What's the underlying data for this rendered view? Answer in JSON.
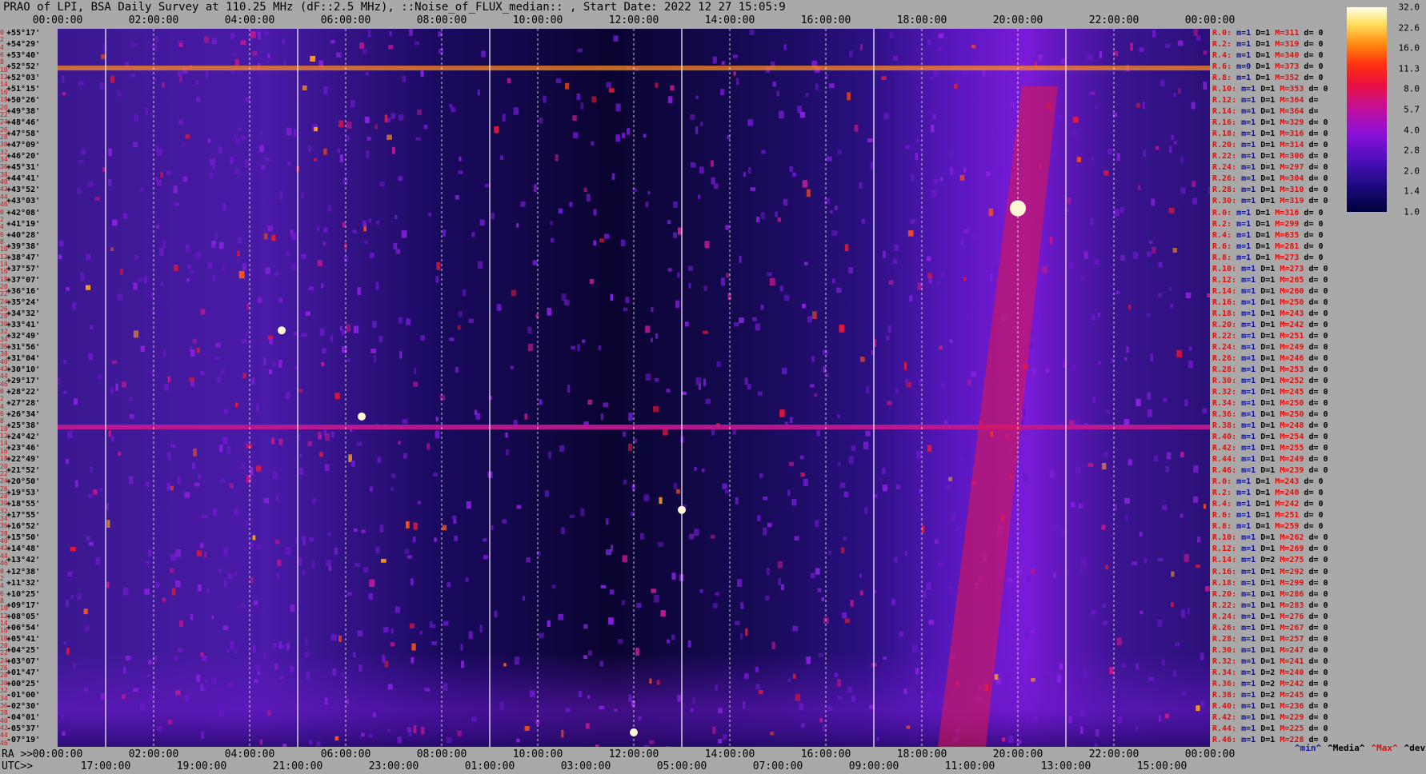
{
  "title": "PRAO of LPI, BSA Daily Survey at 110.25 MHz (dF::2.5 MHz), ::Noise_of_FLUX_median:: , Start Date: 2022 12 27 15:05:9",
  "top_axis_ticks": [
    "00:00:00",
    "02:00:00",
    "04:00:00",
    "06:00:00",
    "08:00:00",
    "10:00:00",
    "12:00:00",
    "14:00:00",
    "16:00:00",
    "18:00:00",
    "20:00:00",
    "22:00:00",
    "00:00:00"
  ],
  "bottom_axis": {
    "ra_prefix": "RA >>",
    "utc_prefix": "UTC>>",
    "ra_ticks": [
      "00:00:00",
      "02:00:00",
      "04:00:00",
      "06:00:00",
      "08:00:00",
      "10:00:00",
      "12:00:00",
      "14:00:00",
      "16:00:00",
      "18:00:00",
      "20:00:00",
      "22:00:00",
      "00:00:00"
    ],
    "utc_ticks": [
      "17:00:00",
      "19:00:00",
      "21:00:00",
      "23:00:00",
      "01:00:00",
      "03:00:00",
      "05:00:00",
      "07:00:00",
      "09:00:00",
      "11:00:00",
      "13:00:00",
      "15:00:00"
    ]
  },
  "legend_keys": [
    {
      "label": "^min^",
      "color": "#1a1a9a"
    },
    {
      "label": "^Media^",
      "color": "#000000"
    },
    {
      "label": "^Max^",
      "color": "#e01010"
    },
    {
      "label": "^devia^",
      "color": "#000000"
    }
  ],
  "colorbar": {
    "labels": [
      "32.0",
      "22.6",
      "16.0",
      "11.3",
      "8.0",
      "5.7",
      "4.0",
      "2.8",
      "2.0",
      "1.4",
      "1.0"
    ]
  },
  "declinations": [
    "+55°17'",
    "+54°29'",
    "+53°40'",
    "+52°52'",
    "+52°03'",
    "+51°15'",
    "+50°26'",
    "+49°38'",
    "+48°46'",
    "+47°58'",
    "+47°09'",
    "+46°20'",
    "+45°31'",
    "+44°41'",
    "+43°52'",
    "+43°03'",
    "+42°08'",
    "+41°19'",
    "+40°28'",
    "+39°38'",
    "+38°47'",
    "+37°57'",
    "+37°07'",
    "+36°16'",
    "+35°24'",
    "+34°32'",
    "+33°41'",
    "+32°49'",
    "+31°56'",
    "+31°04'",
    "+30°10'",
    "+29°17'",
    "+28°22'",
    "+27°28'",
    "+26°34'",
    "+25°38'",
    "+24°42'",
    "+23°46'",
    "+22°49'",
    "+21°52'",
    "+20°50'",
    "+19°53'",
    "+18°55'",
    "+17°55'",
    "+16°52'",
    "+15°50'",
    "+14°48'",
    "+13°42'",
    "+12°38'",
    "+11°32'",
    "+10°25'",
    "+09°17'",
    "+08°05'",
    "+06°54'",
    "+05°41'",
    "+04°25'",
    "+03°07'",
    "+01°47'",
    "+00°25'",
    "-01°00'",
    "-02°30'",
    "-04°01'",
    "-05°37'",
    "-07°19'"
  ],
  "row_indices": [
    "0",
    "2",
    "4",
    "6",
    "8",
    "10",
    "12",
    "14",
    "16",
    "18",
    "20",
    "22",
    "24",
    "26",
    "28",
    "30",
    "32",
    "34",
    "36",
    "38",
    "40",
    "42",
    "44",
    "46",
    "0",
    "2",
    "4",
    "6",
    "8",
    "10",
    "12",
    "14",
    "16",
    "18",
    "20",
    "22",
    "24",
    "26",
    "28",
    "30",
    "32",
    "34",
    "36",
    "38",
    "40",
    "42",
    "44",
    "46",
    "0",
    "2",
    "4",
    "6",
    "8",
    "10",
    "12",
    "14",
    "16",
    "18",
    "20",
    "22",
    "24",
    "26",
    "28",
    "30",
    "32",
    "34",
    "36",
    "38",
    "40",
    "42",
    "44",
    "46",
    "0",
    "2",
    "4",
    "6",
    "8",
    "10",
    "12",
    "14",
    "16",
    "18",
    "20",
    "22",
    "24",
    "26",
    "28",
    "30",
    "32",
    "34",
    "36",
    "38",
    "40",
    "42",
    "44",
    "46"
  ],
  "stats": [
    {
      "r": "R.0:",
      "m": "m=1",
      "D": "D=1",
      "M": "M=311",
      "d": "d= 0"
    },
    {
      "r": "R.2:",
      "m": "m=1",
      "D": "D=1",
      "M": "M=319",
      "d": "d= 0"
    },
    {
      "r": "R.4:",
      "m": "m=1",
      "D": "D=1",
      "M": "M=340",
      "d": "d= 0"
    },
    {
      "r": "R.6:",
      "m": "m=0",
      "D": "D=1",
      "M": "M=373",
      "d": "d= 0"
    },
    {
      "r": "R.8:",
      "m": "m=1",
      "D": "D=1",
      "M": "M=352",
      "d": "d= 0"
    },
    {
      "r": "R.10:",
      "m": "m=1",
      "D": "D=1",
      "M": "M=353",
      "d": "d= 0"
    },
    {
      "r": "R.12:",
      "m": "m=1",
      "D": "D=1",
      "M": "M=364",
      "d": "d="
    },
    {
      "r": "R.14:",
      "m": "m=1",
      "D": "D=1",
      "M": "M=364",
      "d": "d="
    },
    {
      "r": "R.16:",
      "m": "m=1",
      "D": "D=1",
      "M": "M=329",
      "d": "d= 0"
    },
    {
      "r": "R.18:",
      "m": "m=1",
      "D": "D=1",
      "M": "M=316",
      "d": "d= 0"
    },
    {
      "r": "R.20:",
      "m": "m=1",
      "D": "D=1",
      "M": "M=314",
      "d": "d= 0"
    },
    {
      "r": "R.22:",
      "m": "m=1",
      "D": "D=1",
      "M": "M=306",
      "d": "d= 0"
    },
    {
      "r": "R.24:",
      "m": "m=1",
      "D": "D=1",
      "M": "M=297",
      "d": "d= 0"
    },
    {
      "r": "R.26:",
      "m": "m=1",
      "D": "D=1",
      "M": "M=304",
      "d": "d= 0"
    },
    {
      "r": "R.28:",
      "m": "m=1",
      "D": "D=1",
      "M": "M=310",
      "d": "d= 0"
    },
    {
      "r": "R.30:",
      "m": "m=1",
      "D": "D=1",
      "M": "M=319",
      "d": "d= 0"
    },
    {
      "r": "R.0:",
      "m": "m=1",
      "D": "D=1",
      "M": "M=316",
      "d": "d= 0"
    },
    {
      "r": "R.2:",
      "m": "m=1",
      "D": "D=1",
      "M": "M=299",
      "d": "d= 0"
    },
    {
      "r": "R.4:",
      "m": "m=1",
      "D": "D=1",
      "M": "M=635",
      "d": "d= 0"
    },
    {
      "r": "R.6:",
      "m": "m=1",
      "D": "D=1",
      "M": "M=281",
      "d": "d= 0"
    },
    {
      "r": "R.8:",
      "m": "m=1",
      "D": "D=1",
      "M": "M=273",
      "d": "d= 0"
    },
    {
      "r": "R.10:",
      "m": "m=1",
      "D": "D=1",
      "M": "M=273",
      "d": "d= 0"
    },
    {
      "r": "R.12:",
      "m": "m=1",
      "D": "D=1",
      "M": "M=265",
      "d": "d= 0"
    },
    {
      "r": "R.14:",
      "m": "m=1",
      "D": "D=1",
      "M": "M=260",
      "d": "d= 0"
    },
    {
      "r": "R.16:",
      "m": "m=1",
      "D": "D=1",
      "M": "M=250",
      "d": "d= 0"
    },
    {
      "r": "R.18:",
      "m": "m=1",
      "D": "D=1",
      "M": "M=243",
      "d": "d= 0"
    },
    {
      "r": "R.20:",
      "m": "m=1",
      "D": "D=1",
      "M": "M=242",
      "d": "d= 0"
    },
    {
      "r": "R.22:",
      "m": "m=1",
      "D": "D=1",
      "M": "M=251",
      "d": "d= 0"
    },
    {
      "r": "R.24:",
      "m": "m=1",
      "D": "D=1",
      "M": "M=249",
      "d": "d= 0"
    },
    {
      "r": "R.26:",
      "m": "m=1",
      "D": "D=1",
      "M": "M=246",
      "d": "d= 0"
    },
    {
      "r": "R.28:",
      "m": "m=1",
      "D": "D=1",
      "M": "M=253",
      "d": "d= 0"
    },
    {
      "r": "R.30:",
      "m": "m=1",
      "D": "D=1",
      "M": "M=252",
      "d": "d= 0"
    },
    {
      "r": "R.32:",
      "m": "m=1",
      "D": "D=1",
      "M": "M=245",
      "d": "d= 0"
    },
    {
      "r": "R.34:",
      "m": "m=1",
      "D": "D=1",
      "M": "M=250",
      "d": "d= 0"
    },
    {
      "r": "R.36:",
      "m": "m=1",
      "D": "D=1",
      "M": "M=250",
      "d": "d= 0"
    },
    {
      "r": "R.38:",
      "m": "m=1",
      "D": "D=1",
      "M": "M=248",
      "d": "d= 0"
    },
    {
      "r": "R.40:",
      "m": "m=1",
      "D": "D=1",
      "M": "M=254",
      "d": "d= 0"
    },
    {
      "r": "R.42:",
      "m": "m=1",
      "D": "D=1",
      "M": "M=255",
      "d": "d= 0"
    },
    {
      "r": "R.44:",
      "m": "m=1",
      "D": "D=1",
      "M": "M=249",
      "d": "d= 0"
    },
    {
      "r": "R.46:",
      "m": "m=1",
      "D": "D=1",
      "M": "M=239",
      "d": "d= 0"
    },
    {
      "r": "R.0:",
      "m": "m=1",
      "D": "D=1",
      "M": "M=243",
      "d": "d= 0"
    },
    {
      "r": "R.2:",
      "m": "m=1",
      "D": "D=1",
      "M": "M=240",
      "d": "d= 0"
    },
    {
      "r": "R.4:",
      "m": "m=1",
      "D": "D=1",
      "M": "M=242",
      "d": "d= 0"
    },
    {
      "r": "R.6:",
      "m": "m=1",
      "D": "D=1",
      "M": "M=251",
      "d": "d= 0"
    },
    {
      "r": "R.8:",
      "m": "m=1",
      "D": "D=1",
      "M": "M=259",
      "d": "d= 0"
    },
    {
      "r": "R.10:",
      "m": "m=1",
      "D": "D=1",
      "M": "M=262",
      "d": "d= 0"
    },
    {
      "r": "R.12:",
      "m": "m=1",
      "D": "D=1",
      "M": "M=269",
      "d": "d= 0"
    },
    {
      "r": "R.14:",
      "m": "m=1",
      "D": "D=2",
      "M": "M=275",
      "d": "d= 0"
    },
    {
      "r": "R.16:",
      "m": "m=1",
      "D": "D=1",
      "M": "M=292",
      "d": "d= 0"
    },
    {
      "r": "R.18:",
      "m": "m=1",
      "D": "D=1",
      "M": "M=299",
      "d": "d= 0"
    },
    {
      "r": "R.20:",
      "m": "m=1",
      "D": "D=1",
      "M": "M=286",
      "d": "d= 0"
    },
    {
      "r": "R.22:",
      "m": "m=1",
      "D": "D=1",
      "M": "M=283",
      "d": "d= 0"
    },
    {
      "r": "R.24:",
      "m": "m=1",
      "D": "D=1",
      "M": "M=276",
      "d": "d= 0"
    },
    {
      "r": "R.26:",
      "m": "m=1",
      "D": "D=1",
      "M": "M=267",
      "d": "d= 0"
    },
    {
      "r": "R.28:",
      "m": "m=1",
      "D": "D=1",
      "M": "M=257",
      "d": "d= 0"
    },
    {
      "r": "R.30:",
      "m": "m=1",
      "D": "D=1",
      "M": "M=247",
      "d": "d= 0"
    },
    {
      "r": "R.32:",
      "m": "m=1",
      "D": "D=1",
      "M": "M=241",
      "d": "d= 0"
    },
    {
      "r": "R.34:",
      "m": "m=1",
      "D": "D=2",
      "M": "M=240",
      "d": "d= 0"
    },
    {
      "r": "R.36:",
      "m": "m=1",
      "D": "D=2",
      "M": "M=242",
      "d": "d= 0"
    },
    {
      "r": "R.38:",
      "m": "m=1",
      "D": "D=2",
      "M": "M=245",
      "d": "d= 0"
    },
    {
      "r": "R.40:",
      "m": "m=1",
      "D": "D=1",
      "M": "M=236",
      "d": "d= 0"
    },
    {
      "r": "R.42:",
      "m": "m=1",
      "D": "D=1",
      "M": "M=229",
      "d": "d= 0"
    },
    {
      "r": "R.44:",
      "m": "m=1",
      "D": "D=1",
      "M": "M=225",
      "d": "d= 0"
    },
    {
      "r": "R.46:",
      "m": "m=1",
      "D": "D=1",
      "M": "M=228",
      "d": "d= 0"
    }
  ],
  "chart_data": {
    "type": "heatmap",
    "title": "PRAO of LPI, BSA Daily Survey at 110.25 MHz (dF::2.5 MHz), ::Noise_of_FLUX_median:: , Start Date: 2022 12 27 15:05:9",
    "x_axis_top": "RA 00:00:00 to 00:00:00",
    "x_axis_bottom": "UTC 17:00:00 to 15:00:00",
    "y_axis": "Declination +55°17' to -07°19'",
    "color_scale": [
      32.0,
      22.6,
      16.0,
      11.3,
      8.0,
      5.7,
      4.0,
      2.8,
      2.0,
      1.4,
      1.0
    ],
    "colormap": [
      "#00003c",
      "#1a0a7a",
      "#4a10b8",
      "#8a10d8",
      "#c010a0",
      "#e81040",
      "#ff3010",
      "#ff8a10",
      "#ffe060",
      "#ffffe8"
    ],
    "features": {
      "bright_row_dec": [
        "+52°52'",
        "+25°38'"
      ],
      "bright_hot_spots_ra": [
        "20:00:00",
        "04:40:00",
        "12:00:00",
        "06:20:00",
        "13:00:00"
      ],
      "diagonal_streak_ra": [
        "18:40:00",
        "20:40:00"
      ],
      "solid_vertical_lines_ra": [
        "01:00:00",
        "05:00:00",
        "09:00:00",
        "13:00:00",
        "17:00:00",
        "21:00:00"
      ],
      "dashed_vertical_lines_ra": [
        "02:00:00",
        "04:00:00",
        "06:00:00",
        "08:00:00",
        "10:00:00",
        "12:00:00",
        "14:00:00",
        "16:00:00",
        "18:00:00",
        "20:00:00",
        "22:00:00"
      ]
    }
  }
}
